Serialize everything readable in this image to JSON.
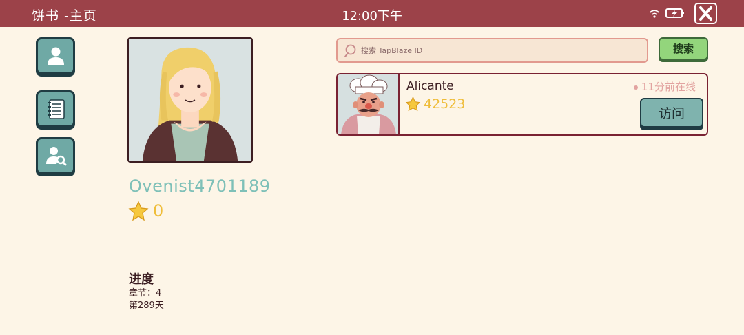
{
  "topbar": {
    "title": "饼书 -主页",
    "clock": "12:00下午",
    "icons": [
      "wifi-icon",
      "battery-charging-icon",
      "close-icon"
    ]
  },
  "sidebar": {
    "items": [
      {
        "name": "profile",
        "icon": "person-icon"
      },
      {
        "name": "notebook",
        "icon": "notebook-icon"
      },
      {
        "name": "find-friend",
        "icon": "person-search-icon"
      }
    ]
  },
  "profile": {
    "username": "Ovenist4701189",
    "stars": "0",
    "progress_title": "进度",
    "chapter": "章节：4",
    "day": "第289天"
  },
  "search": {
    "placeholder": "搜索 TapBlaze ID",
    "button_label": "搜索"
  },
  "friends": [
    {
      "name": "Alicante",
      "stars": "42523",
      "online": "11分前在线",
      "visit_label": "访问"
    }
  ],
  "colors": {
    "topbar": "#9c4249",
    "background": "#fdf5e7",
    "username": "#7ec0b8",
    "star": "#efbd3a",
    "search_button": "#93d57c",
    "visit_button": "#7fb3ae"
  }
}
